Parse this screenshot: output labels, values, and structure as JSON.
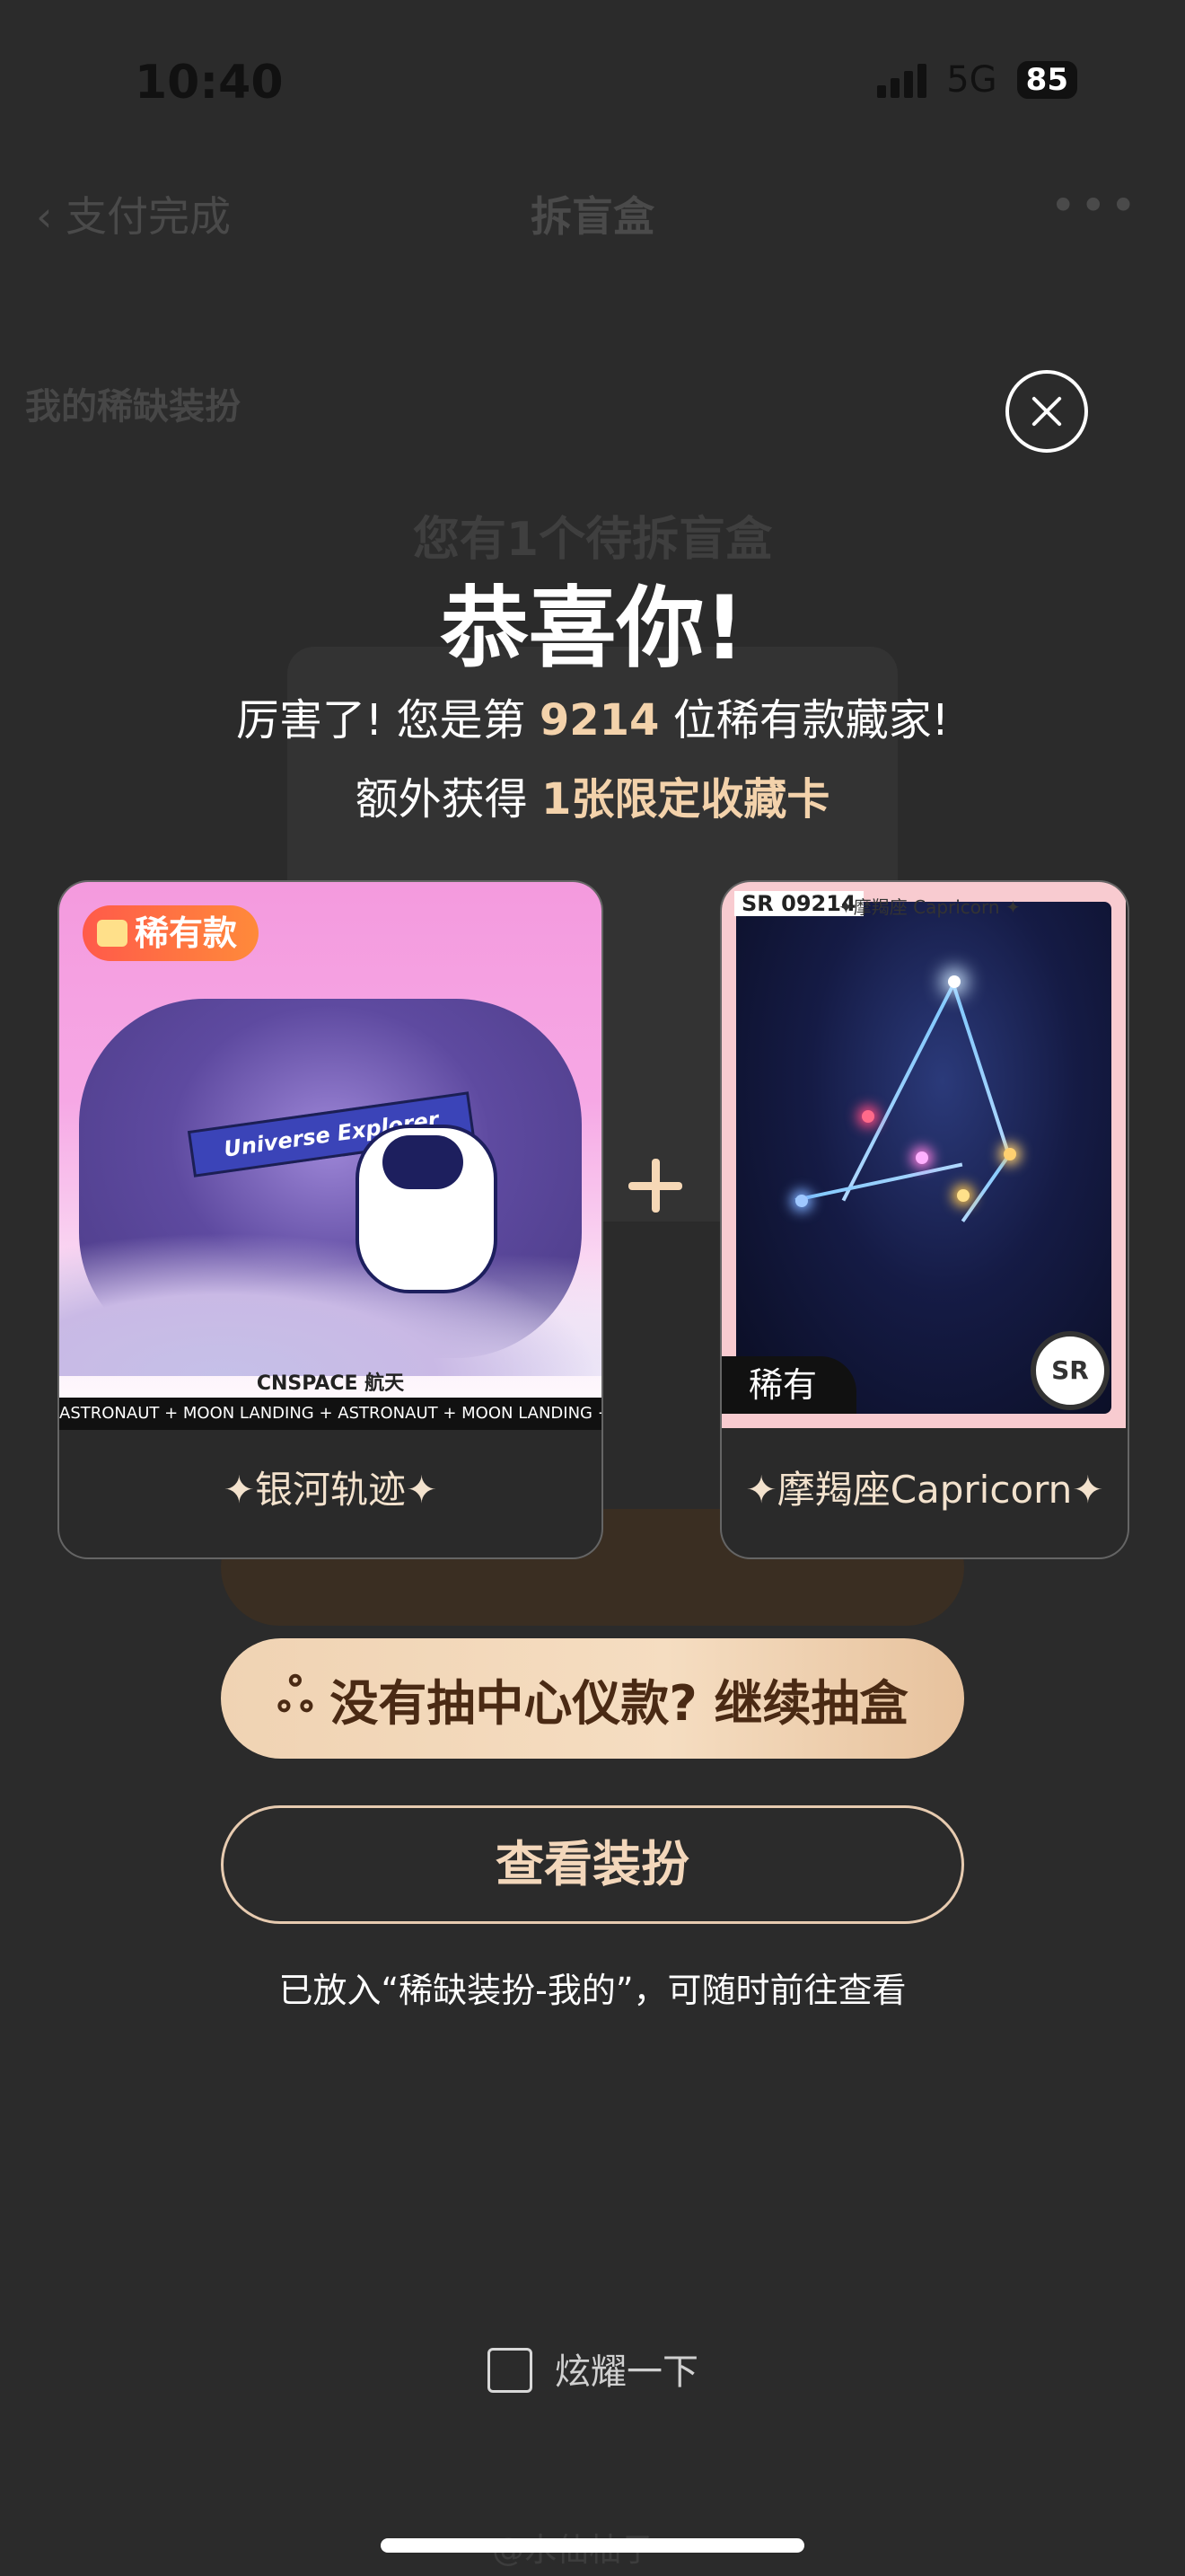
{
  "status_bar": {
    "time": "10:40",
    "network": "5G",
    "battery": "85"
  },
  "nav": {
    "back_label": "支付完成",
    "title": "拆盲盒",
    "more": "•••"
  },
  "section_label": "我的稀缺装扮",
  "pending_text": "您有1个待拆盲盒",
  "modal": {
    "title": "恭喜你!",
    "line1_pre": "厉害了! 您是第",
    "rank": "9214",
    "line1_post": "位稀有款藏家!",
    "line2_pre": "额外获得",
    "line2_highlight": "1张限定收藏卡",
    "cards": [
      {
        "tag": "稀有款",
        "banner": "Universe Explorer",
        "logo": "CNSPACE 航天",
        "strip": "ASTRONAUT + MOON LANDING + ASTRONAUT + MOON LANDING + ASTRONAUT",
        "label": "✦银河轨迹✦"
      },
      {
        "serial": "SR 09214",
        "header": "✦摩羯座 Capricorn ✦",
        "rarity": "稀有",
        "badge": "SR",
        "label": "✦摩羯座Capricorn✦"
      }
    ],
    "continue_button": "没有抽中心仪款? 继续抽盒",
    "view_button": "查看装扮",
    "note": "已放入“稀缺装扮-我的”，可随时前往查看",
    "show_off": "炫耀一下"
  },
  "watermark": "@水仙柚子"
}
